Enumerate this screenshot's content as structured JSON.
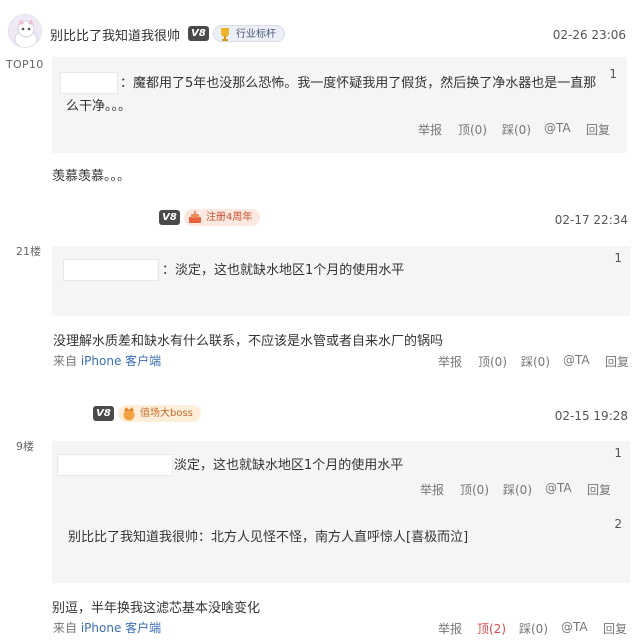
{
  "post1": {
    "username": "别比比了我知道我很帅",
    "level": "V8",
    "badge": "行业标杆",
    "rank": "TOP10",
    "time": "02-26 23:06",
    "quote": {
      "number": "1",
      "separator": "：",
      "line1": "魔都用了5年也没那么恐怖。我一度怀疑我用了假货，然后换了净水器也是一直那",
      "line2": "么干净。。。"
    },
    "quote_actions": [
      "举报",
      "顶(0)",
      "踩(0)",
      "@TA",
      "回复"
    ],
    "reply": "羡慕羡慕。。。"
  },
  "post2": {
    "level": "V8",
    "badge": "注册4周年",
    "floor": "21楼",
    "time": "02-17 22:34",
    "quote": {
      "number": "1",
      "separator": "：",
      "text": "淡定，这也就缺水地区1个月的使用水平"
    },
    "reply": "没理解水质差和缺水有什么联系，不应该是水管或者自来水厂的锅吗",
    "source_prefix": "来自",
    "source_link": "iPhone 客户端",
    "actions": [
      "举报",
      "顶(0)",
      "踩(0)",
      "@TA",
      "回复"
    ]
  },
  "post3": {
    "level": "V8",
    "badge": "值场大boss",
    "floor": "9楼",
    "time": "02-15 19:28",
    "quote1": {
      "number": "1",
      "text": "淡定，这也就缺水地区1个月的使用水平"
    },
    "quote1_actions": [
      "举报",
      "顶(0)",
      "踩(0)",
      "@TA",
      "回复"
    ],
    "quote2": {
      "number": "2",
      "author": "别比比了我知道我很帅",
      "text": "：北方人见怪不怪，南方人直呼惊人[喜极而泣]"
    },
    "reply": "别逗，半年换我这滤芯基本没啥变化",
    "source_prefix": "来自",
    "source_link": "iPhone 客户端",
    "actions": [
      "举报",
      "顶(2)",
      "踩(0)",
      "@TA",
      "回复"
    ]
  },
  "colors": {
    "quote_bg": "#f5f5f5",
    "link": "#3a6db5",
    "active_vote": "#e0484a"
  }
}
